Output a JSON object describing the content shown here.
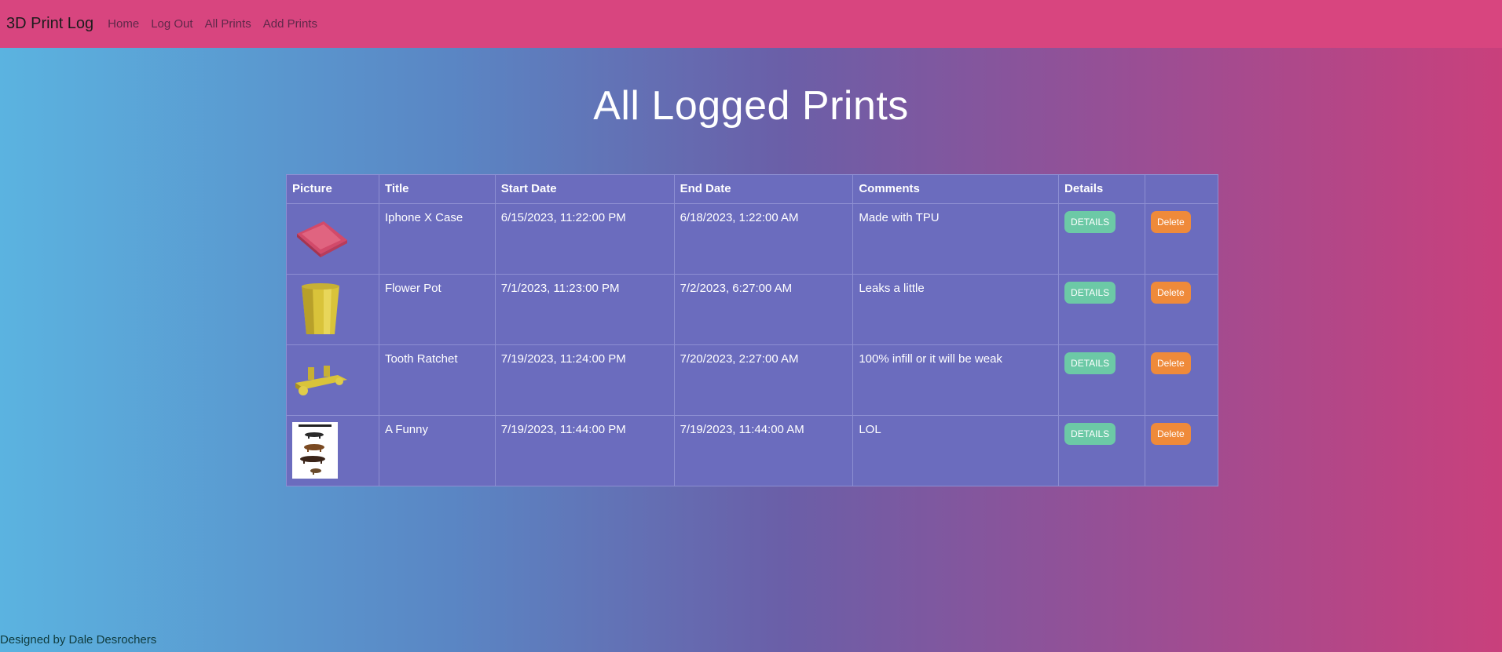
{
  "navbar": {
    "brand": "3D Print Log",
    "links": [
      "Home",
      "Log Out",
      "All Prints",
      "Add Prints"
    ]
  },
  "main": {
    "title": "All Logged Prints",
    "headers": [
      "Picture",
      "Title",
      "Start Date",
      "End Date",
      "Comments",
      "Details",
      ""
    ],
    "details_label": "DETAILS",
    "delete_label": "Delete",
    "rows": [
      {
        "thumbnail": "phone-case-icon",
        "title": "Iphone X Case",
        "start": "6/15/2023, 11:22:00 PM",
        "end": "6/18/2023, 1:22:00 AM",
        "comments": "Made with TPU"
      },
      {
        "thumbnail": "vase-icon",
        "title": "Flower Pot",
        "start": "7/1/2023, 11:23:00 PM",
        "end": "7/2/2023, 6:27:00 AM",
        "comments": "Leaks a little"
      },
      {
        "thumbnail": "ratchet-icon",
        "title": "Tooth Ratchet",
        "start": "7/19/2023, 11:24:00 PM",
        "end": "7/20/2023, 2:27:00 AM",
        "comments": "100% infill or it will be weak"
      },
      {
        "thumbnail": "dog-poster-icon",
        "title": "A Funny",
        "start": "7/19/2023, 11:44:00 PM",
        "end": "7/19/2023, 11:44:00 AM",
        "comments": "LOL"
      }
    ]
  },
  "footer": {
    "text": "Designed by Dale Desrochers"
  },
  "colors": {
    "navbar": "#d8457f",
    "table": "#6b6cbe",
    "details_button": "#6cc9a6",
    "delete_button": "#ef8a3a"
  }
}
